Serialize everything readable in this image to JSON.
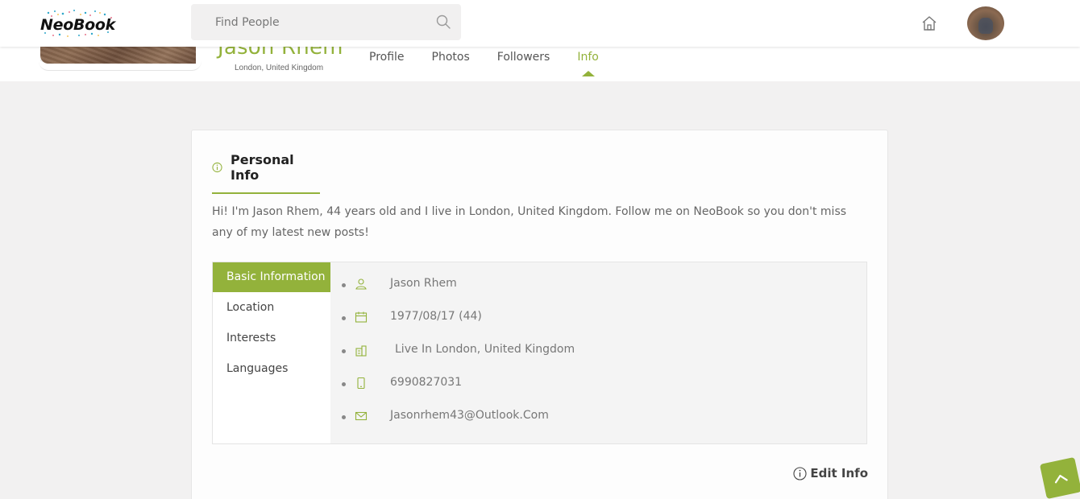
{
  "header": {
    "logo_text": "NeoBook",
    "search": {
      "placeholder": "Find People",
      "value": ""
    }
  },
  "profile": {
    "name": "Jason Rhem",
    "location": "London, United Kingdom",
    "tabs": [
      {
        "label": "Profile",
        "active": false
      },
      {
        "label": "Photos",
        "active": false
      },
      {
        "label": "Followers",
        "active": false
      },
      {
        "label": "Info",
        "active": true
      }
    ]
  },
  "personal_info": {
    "title": "Personal Info",
    "bio": "Hi! I'm Jason Rhem, 44 years old and I live in London, United Kingdom. Follow me on NeoBook so you don't miss any of my latest new posts!",
    "nav": [
      {
        "label": "Basic Information",
        "active": true
      },
      {
        "label": "Location",
        "active": false
      },
      {
        "label": "Interests",
        "active": false
      },
      {
        "label": "Languages",
        "active": false
      }
    ],
    "rows": [
      {
        "icon": "user-icon",
        "text": "Jason Rhem"
      },
      {
        "icon": "calendar-icon",
        "text": "1977/08/17 (44)"
      },
      {
        "icon": "building-icon",
        "text": "Live In London, United Kingdom"
      },
      {
        "icon": "phone-icon",
        "text": "6990827031"
      },
      {
        "icon": "mail-icon",
        "text": "Jasonrhem43@Outlook.Com"
      }
    ],
    "edit_label": "Edit Info"
  },
  "colors": {
    "accent": "#93b23b",
    "background": "#f2f1f1"
  }
}
